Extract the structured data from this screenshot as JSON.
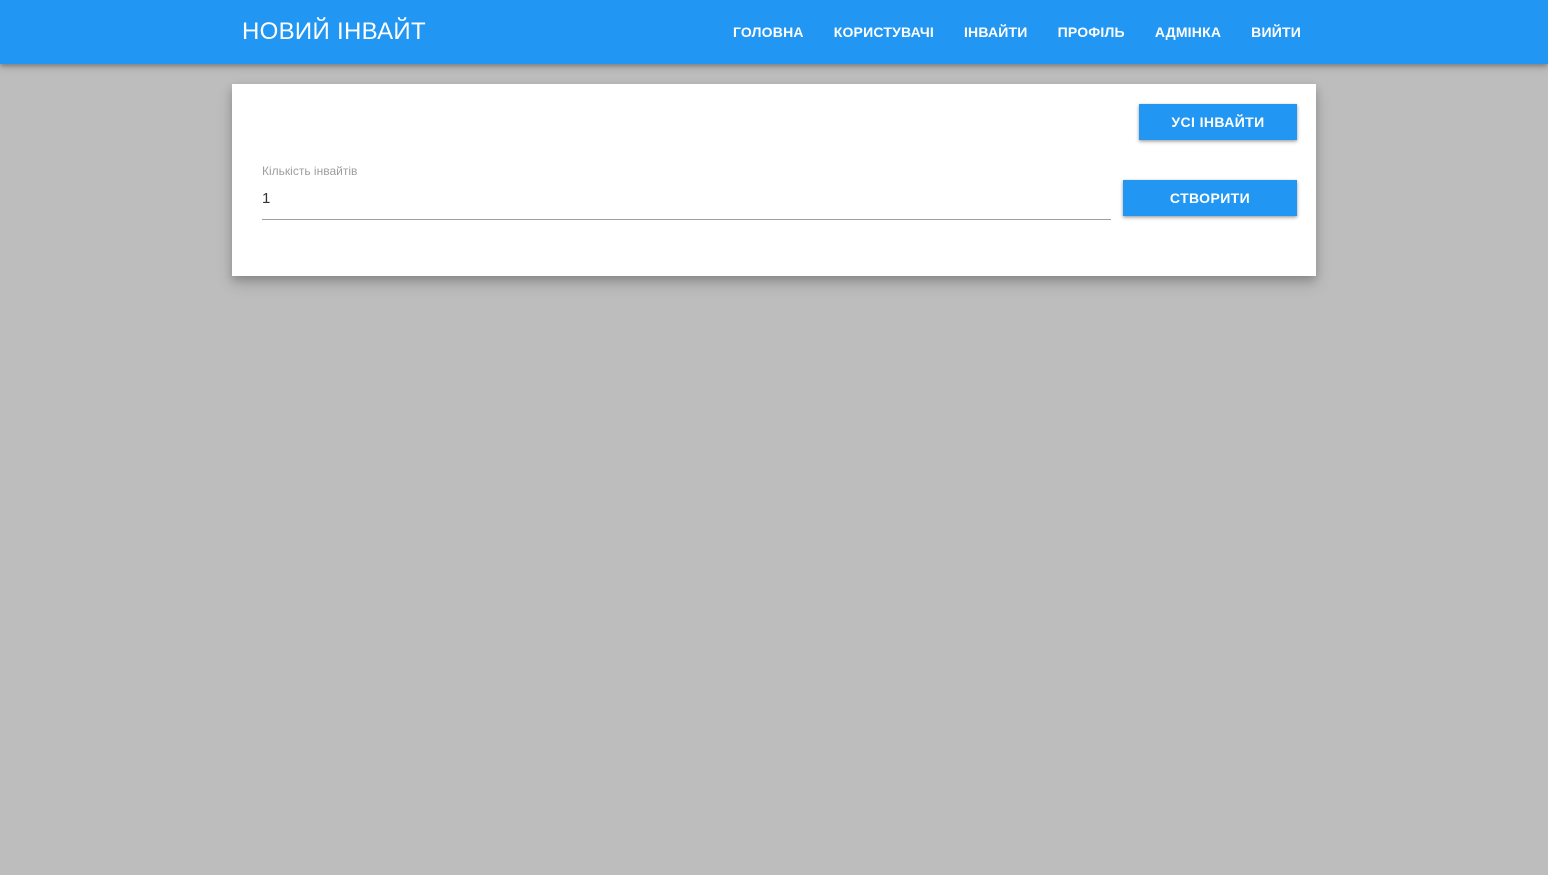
{
  "header": {
    "title": "НОВИЙ ІНВАЙТ",
    "nav": [
      {
        "label": "ГОЛОВНА"
      },
      {
        "label": "КОРИСТУВАЧІ"
      },
      {
        "label": "ІНВАЙТИ"
      },
      {
        "label": "ПРОФІЛЬ"
      },
      {
        "label": "АДМІНКА"
      },
      {
        "label": "ВИЙТИ"
      }
    ],
    "colors": {
      "accent": "#2196f3"
    }
  },
  "main": {
    "all_invites_label": "УСІ ІНВАЙТИ",
    "count_field": {
      "label": "Кількість інвайтів",
      "value": "1"
    },
    "create_label": "СТВОРИТИ"
  }
}
